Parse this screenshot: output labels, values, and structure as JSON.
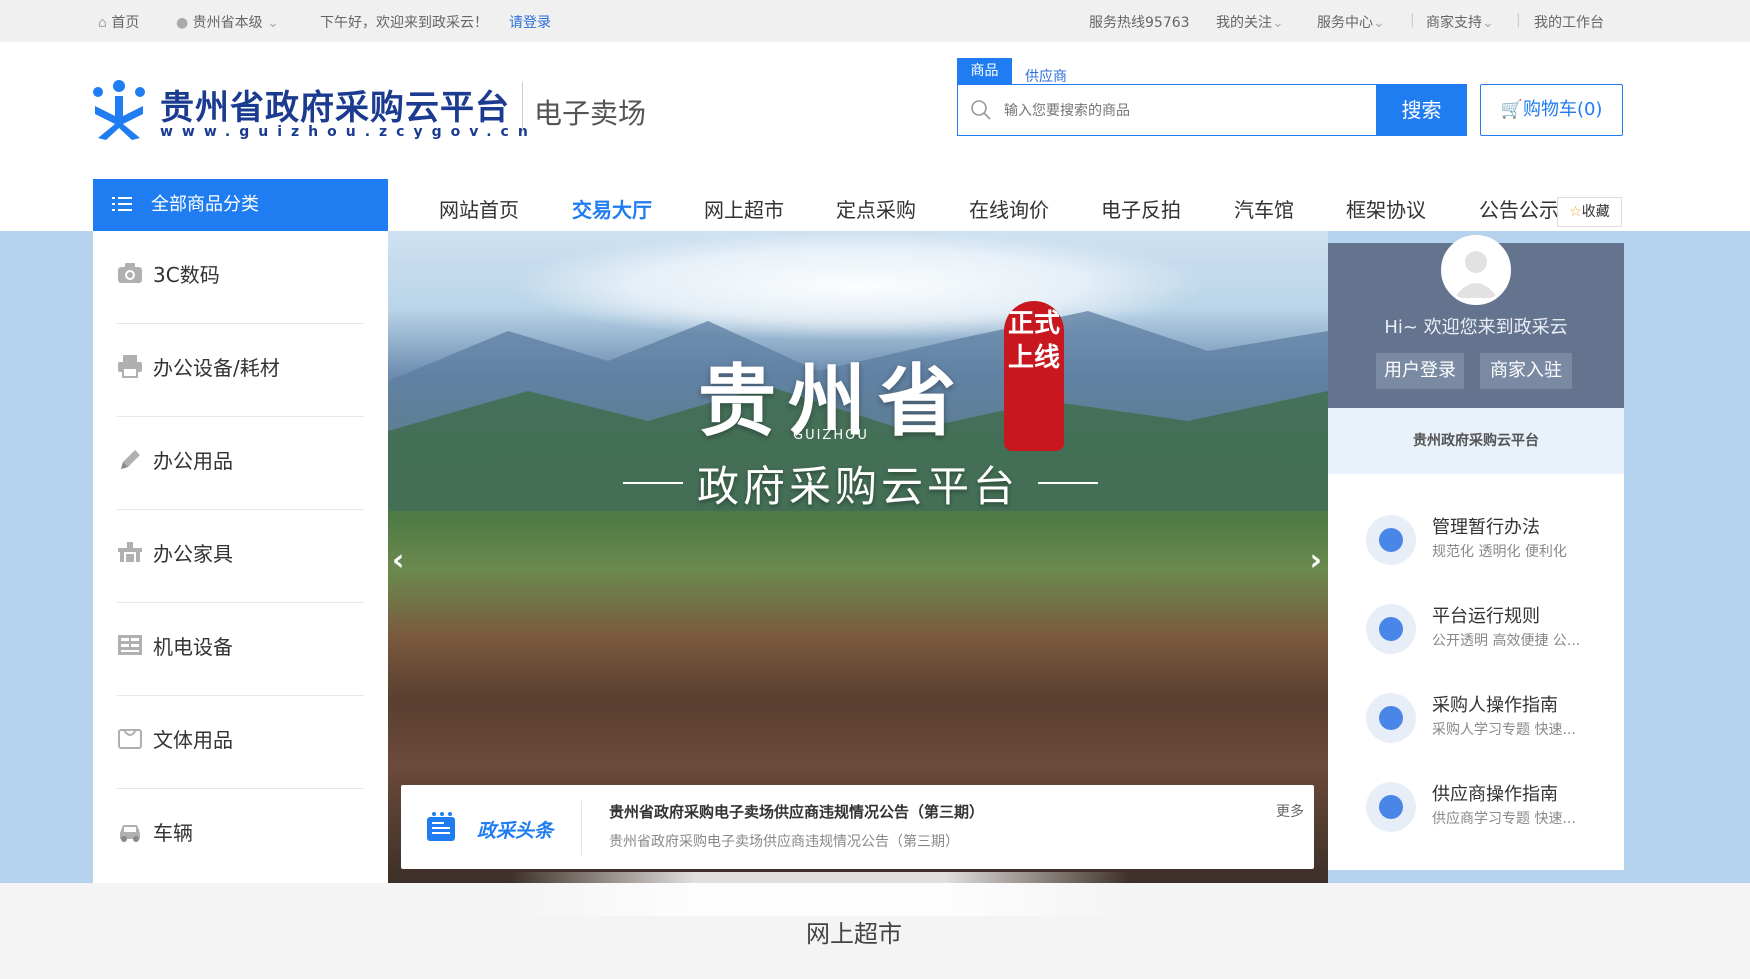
{
  "topbar": {
    "home": "首页",
    "region": "贵州省本级",
    "greeting": "下午好，欢迎来到政采云！",
    "login": "请登录",
    "hotline": "服务热线95763",
    "follow": "我的关注",
    "service_center": "服务中心",
    "merchant_support": "商家支持",
    "workbench": "我的工作台"
  },
  "header": {
    "logo_title": "贵州省政府采购云平台",
    "logo_url": "www.guizhou.zcygov.cn",
    "logo_sub": "电子卖场"
  },
  "search": {
    "tabs": [
      "商品",
      "供应商"
    ],
    "placeholder": "输入您要搜索的商品",
    "button": "搜索",
    "cart": "购物车(0)"
  },
  "nav": {
    "all_categories": "全部商品分类",
    "items": [
      "网站首页",
      "交易大厅",
      "网上超市",
      "定点采购",
      "在线询价",
      "电子反拍",
      "汽车馆",
      "框架协议",
      "公告公示"
    ],
    "active_index": 1,
    "favorite": "收藏"
  },
  "categories": [
    {
      "label": "3C数码",
      "icon": "camera-icon"
    },
    {
      "label": "办公设备/耗材",
      "icon": "printer-icon"
    },
    {
      "label": "办公用品",
      "icon": "pen-icon"
    },
    {
      "label": "办公家具",
      "icon": "furniture-icon"
    },
    {
      "label": "机电设备",
      "icon": "machine-icon"
    },
    {
      "label": "文体用品",
      "icon": "bag-icon"
    },
    {
      "label": "车辆",
      "icon": "car-icon"
    }
  ],
  "banner": {
    "title": "贵州省",
    "title_pinyin": "GUIZHOU",
    "seal": "正式上线",
    "subtitle": "政府采购云平台"
  },
  "news": {
    "brand": "政采头条",
    "title": "贵州省政府采购电子卖场供应商违规情况公告（第三期）",
    "subtitle": "贵州省政府采购电子卖场供应商违规情况公告（第三期）",
    "more": "更多"
  },
  "user_panel": {
    "welcome": "Hi~ 欢迎您来到政采云",
    "login_button": "用户登录",
    "merchant_button": "商家入驻",
    "platform": "贵州政府采购云平台",
    "items": [
      {
        "title": "管理暂行办法",
        "subtitle": "规范化 透明化 便利化"
      },
      {
        "title": "平台运行规则",
        "subtitle": "公开透明 高效便捷 公..."
      },
      {
        "title": "采购人操作指南",
        "subtitle": "采购人学习专题 快速..."
      },
      {
        "title": "供应商操作指南",
        "subtitle": "供应商学习专题 快速..."
      }
    ]
  },
  "section": {
    "title": "网上超市"
  }
}
